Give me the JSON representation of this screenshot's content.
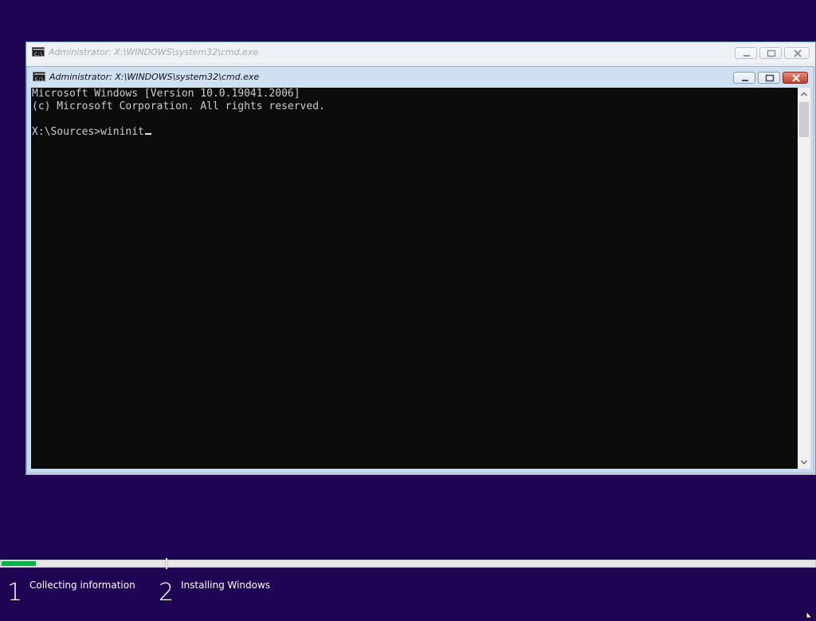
{
  "background_window": {
    "title": "Administrator: X:\\WINDOWS\\system32\\cmd.exe",
    "icon": "cmd-icon"
  },
  "console_window": {
    "title": "Administrator: X:\\WINDOWS\\system32\\cmd.exe",
    "icon": "cmd-icon",
    "lines": [
      "Microsoft Windows [Version 10.0.19041.2006]",
      "(c) Microsoft Corporation. All rights reserved.",
      "",
      "X:\\Sources>wininit"
    ]
  },
  "setup_progress": {
    "progress_fraction_step1": 0.21,
    "steps": [
      {
        "number": "1",
        "label": "Collecting information"
      },
      {
        "number": "2",
        "label": "Installing Windows"
      }
    ]
  },
  "colors": {
    "desktop_background": "#200454",
    "progress_fill": "#05b34b",
    "console_background": "#0c0c0c",
    "close_button": "#c2412c"
  }
}
